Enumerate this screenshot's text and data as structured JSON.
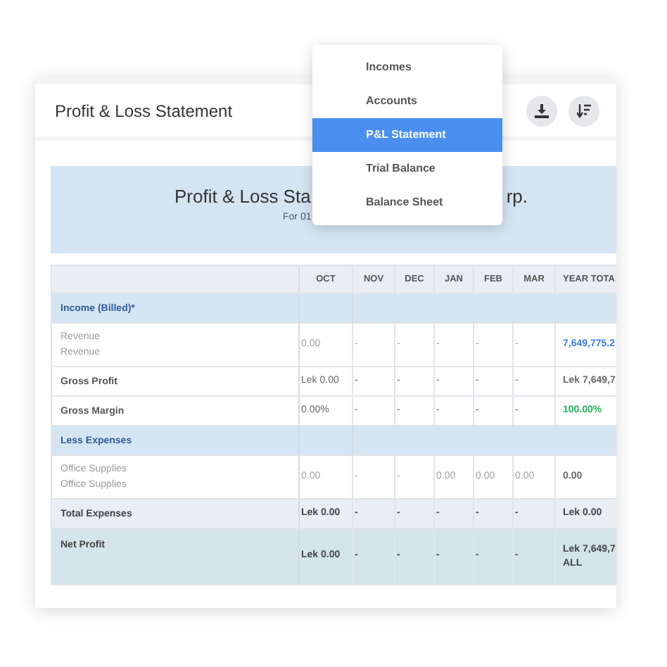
{
  "header": {
    "title": "Profit & Loss Statement"
  },
  "menu": [
    {
      "label": "Incomes",
      "selected": false
    },
    {
      "label": "Accounts",
      "selected": false
    },
    {
      "label": "P&L Statement",
      "selected": true
    },
    {
      "label": "Trial Balance",
      "selected": false
    },
    {
      "label": "Balance Sheet",
      "selected": false
    }
  ],
  "report": {
    "title_start": "Profit & Loss Sta",
    "title_end": "rp.",
    "subtitle": "For 01"
  },
  "table": {
    "columns": [
      "OCT",
      "NOV",
      "DEC",
      "JAN",
      "FEB",
      "MAR",
      "YEAR TOTA"
    ],
    "rows": [
      {
        "kind": "section",
        "label": [
          "Income (Billed)*"
        ]
      },
      {
        "kind": "item",
        "label": [
          "Revenue",
          "Revenue"
        ],
        "cells": [
          "0.00",
          "-",
          "-",
          "-",
          "-",
          "-"
        ],
        "total": "7,649,775.2",
        "color": "#3b7be0"
      },
      {
        "kind": "plain",
        "label": [
          "Gross Profit"
        ],
        "cells": [
          "Lek 0.00",
          "-",
          "-",
          "-",
          "-",
          "-"
        ],
        "total": "Lek 7,649,7"
      },
      {
        "kind": "plain",
        "label": [
          "Gross Margin"
        ],
        "cells": [
          "0.00%",
          "-",
          "-",
          "-",
          "-",
          "-"
        ],
        "total": "100.00%",
        "color": "#22b35e"
      },
      {
        "kind": "section",
        "label": [
          "Less Expenses"
        ]
      },
      {
        "kind": "item",
        "label": [
          "Office Supplies",
          "Office Supplies"
        ],
        "cells": [
          "0.00",
          "-",
          "-",
          "0.00",
          "0.00",
          "0.00"
        ],
        "total": "0.00"
      },
      {
        "kind": "total",
        "label": [
          "Total Expenses"
        ],
        "cells": [
          "Lek 0.00",
          "-",
          "-",
          "-",
          "-",
          "-"
        ],
        "total": "Lek 0.00"
      },
      {
        "kind": "net",
        "label": [
          "Net Profit"
        ],
        "cells": [
          "Lek 0.00",
          "-",
          "-",
          "-",
          "-",
          "-"
        ],
        "total": "Lek 7,649,7 ALL"
      }
    ]
  }
}
